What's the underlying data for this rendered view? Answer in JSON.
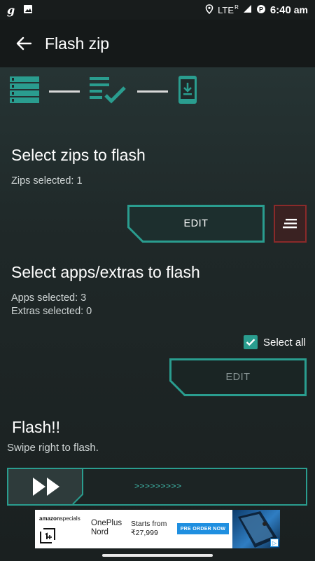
{
  "status_bar": {
    "left_icons": [
      "g-app-icon",
      "image-icon"
    ],
    "network": "LTE",
    "roaming_mark": "R",
    "time": "6:40",
    "ampm": "am"
  },
  "toolbar": {
    "title": "Flash zip"
  },
  "stepper": {
    "steps": [
      "list-icon",
      "checklist-icon",
      "phone-download-icon"
    ],
    "accent_color": "#2a9d8f"
  },
  "zips_section": {
    "title": "Select zips to flash",
    "zips_selected": "Zips selected: 1",
    "edit_label": "EDIT"
  },
  "apps_section": {
    "title": "Select apps/extras to flash",
    "apps_selected": "Apps selected: 3",
    "extras_selected": "Extras selected: 0",
    "select_all_label": "Select all",
    "select_all_checked": true,
    "edit_label": "EDIT"
  },
  "flash_section": {
    "title": "Flash!!",
    "subtitle": "Swipe right to flash.",
    "swipe_arrows": ">>>>>>>>>"
  },
  "ad": {
    "brand": "amazon",
    "brand_suffix": "specials",
    "product_line1": "OnePlus",
    "product_line2": "Nord",
    "price_prefix": "Starts from",
    "price": "₹27,999",
    "cta": "PRE ORDER NOW"
  },
  "colors": {
    "accent": "#2a9d8f",
    "danger": "#8a2a2a"
  }
}
